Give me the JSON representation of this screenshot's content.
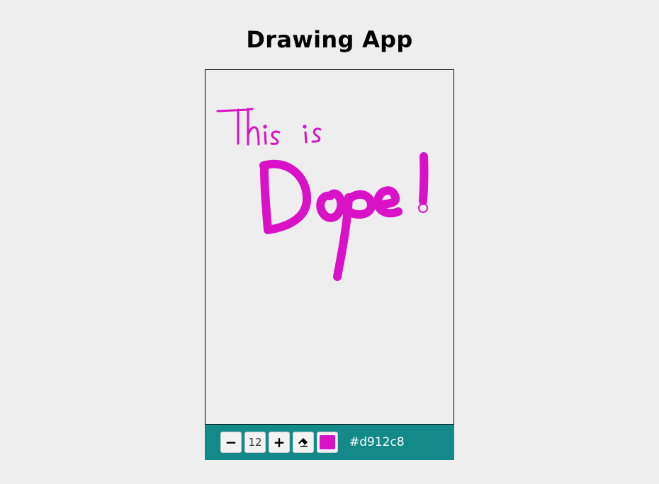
{
  "app": {
    "title": "Drawing App"
  },
  "toolbar": {
    "decrease_label": "−",
    "brush_size": "12",
    "increase_label": "+",
    "eraser_icon": "eraser-icon",
    "current_color": "#d912c8",
    "current_color_label": "#d912c8"
  },
  "canvas": {
    "background": "#eeeeee",
    "stroke_color": "#d912c8",
    "handwriting": "This is Dope!"
  }
}
